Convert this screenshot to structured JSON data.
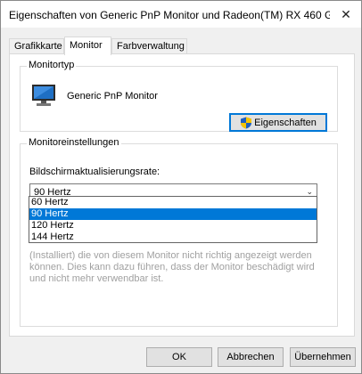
{
  "window": {
    "title": "Eigenschaften von Generic PnP Monitor und Radeon(TM) RX 460 G...",
    "close_glyph": "✕"
  },
  "tabs": [
    {
      "label": "Grafikkarte"
    },
    {
      "label": "Monitor"
    },
    {
      "label": "Farbverwaltung"
    }
  ],
  "monitor_type": {
    "group_label": "Monitortyp",
    "monitor_name": "Generic PnP Monitor",
    "properties_button": "Eigenschaften",
    "icon": "monitor-icon"
  },
  "monitor_settings": {
    "group_label": "Monitoreinstellungen",
    "refresh_label": "Bildschirmaktualisierungsrate:",
    "selected_rate": "90 Hertz",
    "options": [
      "60 Hertz",
      "90 Hertz",
      "120 Hertz",
      "144 Hertz"
    ],
    "selected_index": 1,
    "warning_text": "(Installiert) die von diesem Monitor nicht richtig angezeigt werden können. Dies kann dazu führen, dass der Monitor beschädigt wird und nicht mehr verwendbar ist."
  },
  "buttons": {
    "ok": "OK",
    "cancel": "Abbrechen",
    "apply": "Übernehmen"
  },
  "colors": {
    "accent": "#0078d7",
    "shield_blue": "#1f5fbf",
    "shield_yellow": "#f5c400"
  }
}
